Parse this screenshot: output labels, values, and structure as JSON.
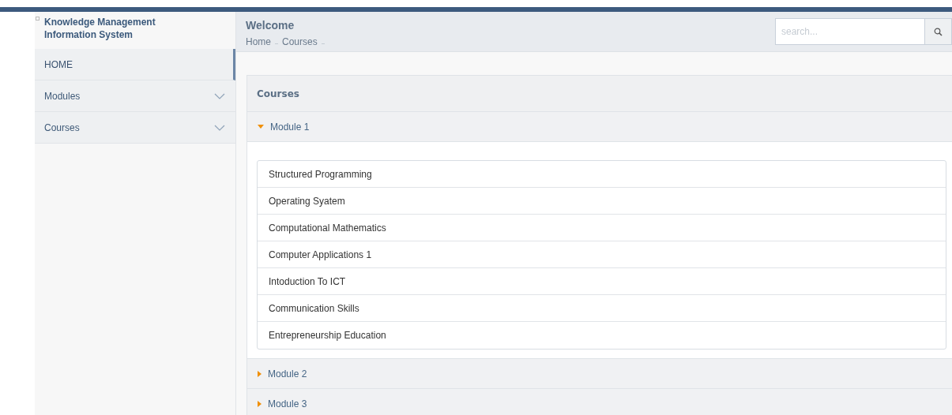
{
  "brand": {
    "title": "Knowledge Management Information System"
  },
  "sidebar": {
    "items": [
      {
        "label": "HOME",
        "selected": true,
        "has_submenu": false
      },
      {
        "label": "Modules",
        "selected": false,
        "has_submenu": true
      },
      {
        "label": "Courses",
        "selected": false,
        "has_submenu": true
      }
    ]
  },
  "header": {
    "title": "Welcome",
    "breadcrumb": [
      "Home",
      "Courses"
    ]
  },
  "search": {
    "placeholder": "search..."
  },
  "panel": {
    "title": "Courses",
    "modules": [
      {
        "label": "Module 1",
        "expanded": true,
        "courses": [
          "Structured Programming",
          "Operating Syatem",
          "Computational Mathematics",
          "Computer Applications 1",
          "Intoduction To ICT",
          "Communication Skills",
          "Entrepreneurship Education"
        ]
      },
      {
        "label": "Module 2",
        "expanded": false
      },
      {
        "label": "Module 3",
        "expanded": false
      }
    ]
  }
}
